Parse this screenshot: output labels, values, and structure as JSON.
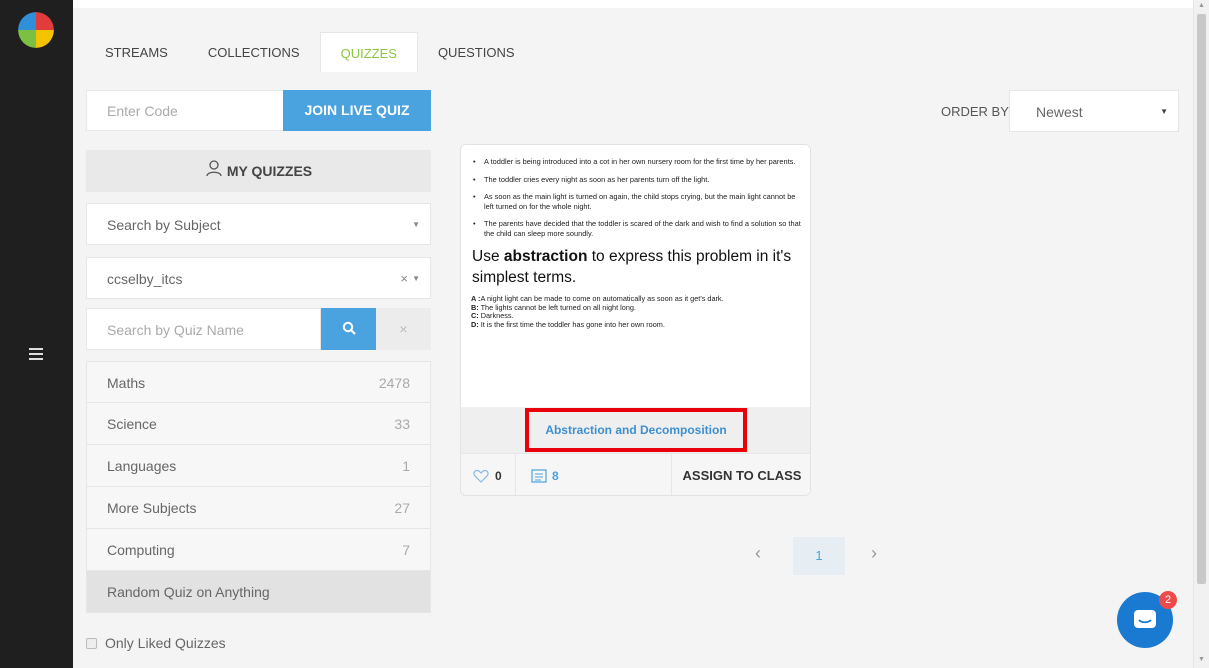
{
  "tabs": [
    {
      "label": "STREAMS"
    },
    {
      "label": "COLLECTIONS"
    },
    {
      "label": "QUIZZES",
      "active": true
    },
    {
      "label": "QUESTIONS"
    }
  ],
  "live_quiz": {
    "code_placeholder": "Enter Code",
    "join_label": "JOIN LIVE QUIZ"
  },
  "my_quizzes_label": "MY QUIZZES",
  "subject_filter": {
    "placeholder": "Search by Subject"
  },
  "user_filter": {
    "value": "ccselby_itcs"
  },
  "quiz_search": {
    "placeholder": "Search by Quiz Name",
    "clear_label": "×"
  },
  "subjects": [
    {
      "label": "Maths",
      "count": "2478"
    },
    {
      "label": "Science",
      "count": "33"
    },
    {
      "label": "Languages",
      "count": "1"
    },
    {
      "label": "More Subjects",
      "count": "27"
    },
    {
      "label": "Computing",
      "count": "7"
    },
    {
      "label": "Random Quiz on Anything",
      "count": "",
      "active": true
    }
  ],
  "only_liked_label": "Only Liked Quizzes",
  "order": {
    "label": "ORDER BY:",
    "value": "Newest"
  },
  "quiz_card": {
    "bullets": [
      "A toddler is being introduced into a cot in her own nursery room for the first time by her parents.",
      "The toddler cries every night as soon as her parents turn off the light.",
      "As soon as the main light is turned on again, the child stops crying, but the main light cannot be left turned on for the whole night.",
      "The parents have decided that the toddler is scared of the dark and wish to find a solution so that the child can sleep more soundly."
    ],
    "question_prefix": "Use ",
    "question_bold": "abstraction",
    "question_suffix": " to express this problem in it's simplest terms.",
    "answers": [
      {
        "key": "A :",
        "text": "A night light can be made to come on automatically as soon as it get's dark."
      },
      {
        "key": "B:",
        "text": " The lights cannot be left turned on all night long."
      },
      {
        "key": "C:",
        "text": " Darkness."
      },
      {
        "key": "D:",
        "text": " It is the first time the toddler has gone into her own room."
      }
    ],
    "tag": "Abstraction and Decomposition",
    "likes": "0",
    "question_count": "8",
    "assign_label": "ASSIGN TO CLASS"
  },
  "pagination": {
    "prev": "‹",
    "page": "1",
    "next": "›"
  },
  "chat": {
    "badge": "2"
  },
  "colors": {
    "accent_blue": "#4aa3df",
    "active_tab_green": "#8cc63f",
    "highlight_red": "#e8000b",
    "sidebar_dark": "#1f1f1f"
  }
}
